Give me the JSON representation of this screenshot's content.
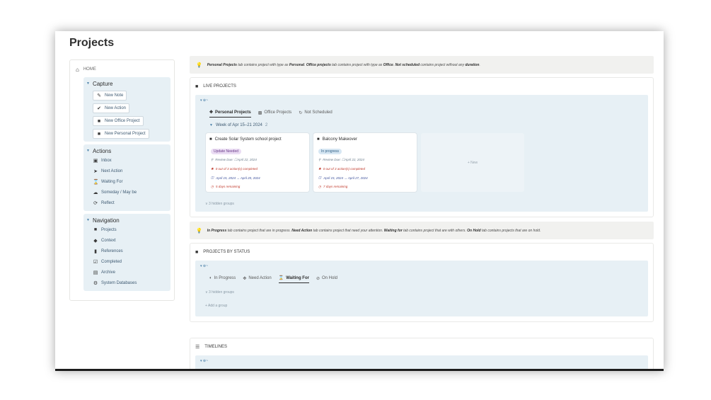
{
  "page": {
    "title": "Projects"
  },
  "sidebar": {
    "home_label": "HOME",
    "capture": {
      "title": "Capture",
      "items": [
        {
          "label": "New Note",
          "icon": "edit-icon"
        },
        {
          "label": "New Action",
          "icon": "check-circle-icon"
        },
        {
          "label": "New Office Project",
          "icon": "folder-icon"
        },
        {
          "label": "New Personal Project",
          "icon": "folder-icon"
        }
      ]
    },
    "actions": {
      "title": "Actions",
      "items": [
        {
          "label": "Inbox",
          "icon": "inbox-icon"
        },
        {
          "label": "Next Action",
          "icon": "arrow-circle-icon"
        },
        {
          "label": "Waiting For",
          "icon": "hourglass-icon"
        },
        {
          "label": "Someday / May be",
          "icon": "cloud-icon"
        },
        {
          "label": "Reflect",
          "icon": "reflect-icon"
        }
      ]
    },
    "navigation": {
      "title": "Navigation",
      "items": [
        {
          "label": "Projects",
          "icon": "folder-icon"
        },
        {
          "label": "Context",
          "icon": "tag-icon"
        },
        {
          "label": "References",
          "icon": "bookmark-icon"
        },
        {
          "label": "Completed",
          "icon": "checkbox-icon"
        },
        {
          "label": "Archive",
          "icon": "archive-icon"
        },
        {
          "label": "System Databases",
          "icon": "gear-icon"
        }
      ]
    }
  },
  "callout1": {
    "b1": "Personal Projects",
    "t1": " tab contains project with type as ",
    "b2": "Personal",
    "t2": ". ",
    "b3": "Office projects",
    "t3": " tab contains project with type as ",
    "b4": "Office",
    "t4": ". ",
    "b5": "Not scheduled",
    "t5": " contains project without any ",
    "b6": "duration",
    "t6": "."
  },
  "live": {
    "heading": "LIVE PROJECTS",
    "toggle": "▾  ⊕~",
    "tabs": [
      {
        "label": "Personal Projects",
        "icon": "person-icon"
      },
      {
        "label": "Office Projects",
        "icon": "briefcase-icon"
      },
      {
        "label": "Not Scheduled",
        "icon": "refresh-icon"
      }
    ],
    "group_label": "Week of Apr 15–21 2024",
    "group_count": "2",
    "cards": [
      {
        "title": "Create Solar System school project",
        "status": "Update Needed",
        "review": "Review Due: ☐April 22, 2024",
        "actions": "0 out of 3 action(s) completed",
        "dates": "April 15, 2024 → April 20, 2024",
        "remaining": "5 days remaining"
      },
      {
        "title": "Balcony Makeover",
        "status": "In progress",
        "review": "Review Due: ☐April 22, 2024",
        "actions": "0 out of 3 action(s) completed",
        "dates": "April 15, 2024 → April 27, 2024",
        "remaining": "7 days remaining"
      }
    ],
    "new_label": "+ New",
    "hidden_groups": "∨ 3 hidden groups"
  },
  "callout2": {
    "b1": "In Progress",
    "t1": " tab contains project that are in progress. ",
    "b2": "Need Action",
    "t2": " tab contains project that need your attention. ",
    "b3": "Waiting for",
    "t3": " tab contains project that are with others. ",
    "b4": "On Hold",
    "t4": " tab contains projects that are on hold."
  },
  "status": {
    "heading": "PROJECTS BY STATUS",
    "toggle": "▾  ⊕~",
    "tabs": [
      {
        "label": "In Progress",
        "icon": "progress-icon"
      },
      {
        "label": "Need Action",
        "icon": "person-icon"
      },
      {
        "label": "Waiting For",
        "icon": "hourglass-icon"
      },
      {
        "label": "On Hold",
        "icon": "pause-icon"
      }
    ],
    "hidden_groups": "∨ 3 hidden groups",
    "add_group": "+ Add a group"
  },
  "timelines": {
    "heading": "TIMELINES",
    "toggle": "▾  ⊕~"
  }
}
